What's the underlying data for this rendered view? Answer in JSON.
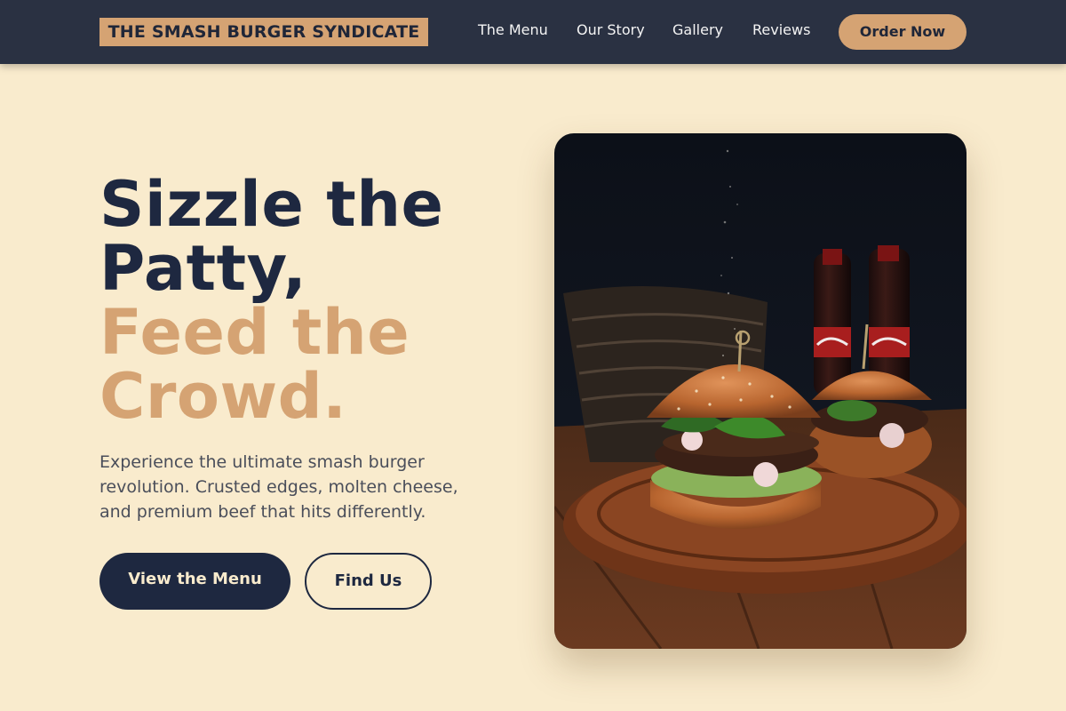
{
  "brand": {
    "name": "THE SMASH BURGER SYNDICATE"
  },
  "nav": {
    "links": [
      "The Menu",
      "Our Story",
      "Gallery",
      "Reviews"
    ],
    "cta": "Order Now"
  },
  "hero": {
    "title_lines": [
      "Sizzle the",
      "Patty,"
    ],
    "accent_lines": [
      "Feed the",
      "Crowd."
    ],
    "description": "Experience the ultimate smash burger revolution. Crusted edges, molten cheese, and premium beef that hits differently.",
    "primary_button": "View the Menu",
    "secondary_button": "Find Us"
  },
  "image": {
    "subject": "smash burgers on a wooden board with cola bottles"
  },
  "colors": {
    "background": "#f9ebcd",
    "navbar": "#2a3142",
    "accent": "#d5a373",
    "dark": "#1e2840"
  }
}
